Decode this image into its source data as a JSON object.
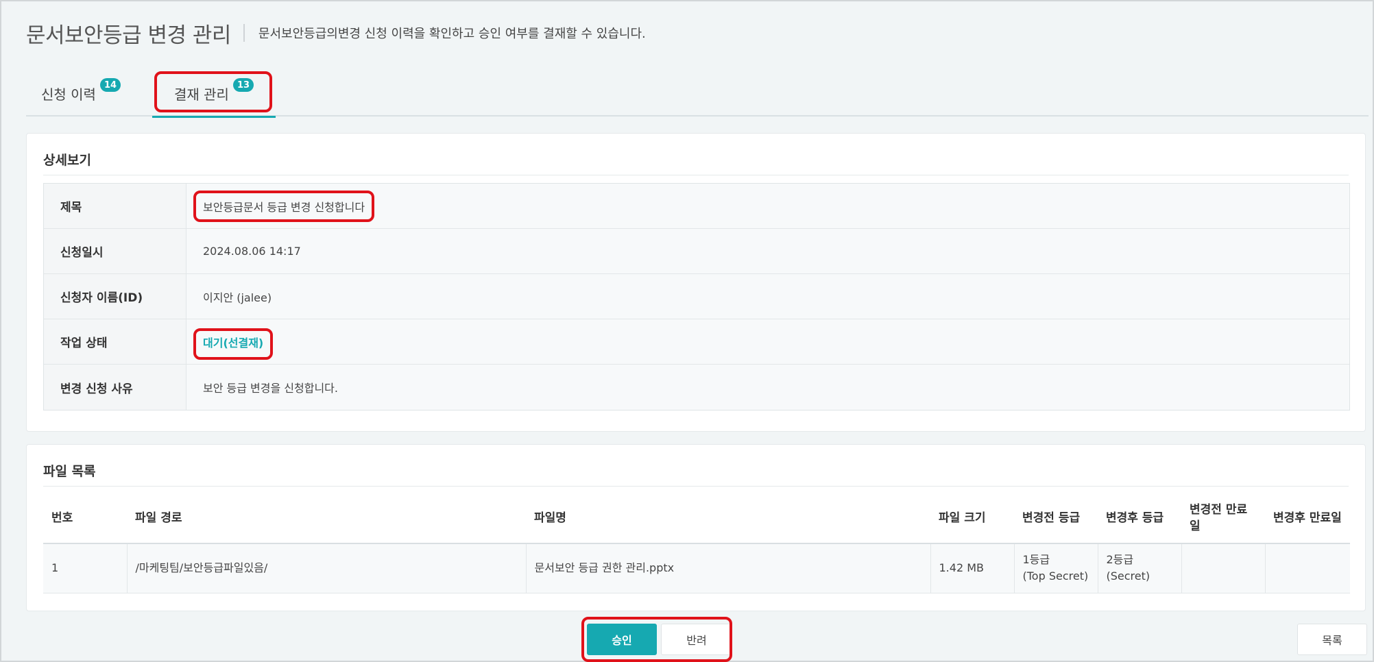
{
  "header": {
    "title": "문서보안등급 변경 관리",
    "description": "문서보안등급의변경 신청 이력을 확인하고 승인 여부를 결재할 수 있습니다."
  },
  "tabs": [
    {
      "label": "신청 이력",
      "count": "14"
    },
    {
      "label": "결재 관리",
      "count": "13"
    }
  ],
  "detail": {
    "title": "상세보기",
    "rows": [
      {
        "label": "제목",
        "value": "보안등급문서 등급 변경 신청합니다"
      },
      {
        "label": "신청일시",
        "value": "2024.08.06 14:17"
      },
      {
        "label": "신청자 이름(ID)",
        "value": "이지안 (jalee)"
      },
      {
        "label": "작업 상태",
        "value": "대기(선결재)"
      },
      {
        "label": "변경 신청 사유",
        "value": "보안 등급 변경을 신청합니다."
      }
    ]
  },
  "files": {
    "title": "파일 목록",
    "columns": [
      "번호",
      "파일 경로",
      "파일명",
      "파일 크기",
      "변경전 등급",
      "변경후 등급",
      "변경전 만료일",
      "변경후 만료일"
    ],
    "rows": [
      {
        "no": "1",
        "path": "/마케팅팀/보안등급파일있음/",
        "name": "문서보안 등급 권한 관리.pptx",
        "size": "1.42 MB",
        "before_grade": "1등급",
        "before_grade_sub": "(Top Secret)",
        "after_grade": "2등급",
        "after_grade_sub": "(Secret)",
        "before_expire": "",
        "after_expire": ""
      }
    ]
  },
  "buttons": {
    "approve": "승인",
    "reject": "반려",
    "list": "목록"
  },
  "colors": {
    "accent": "#16a9b1",
    "highlight": "#e0121a"
  }
}
